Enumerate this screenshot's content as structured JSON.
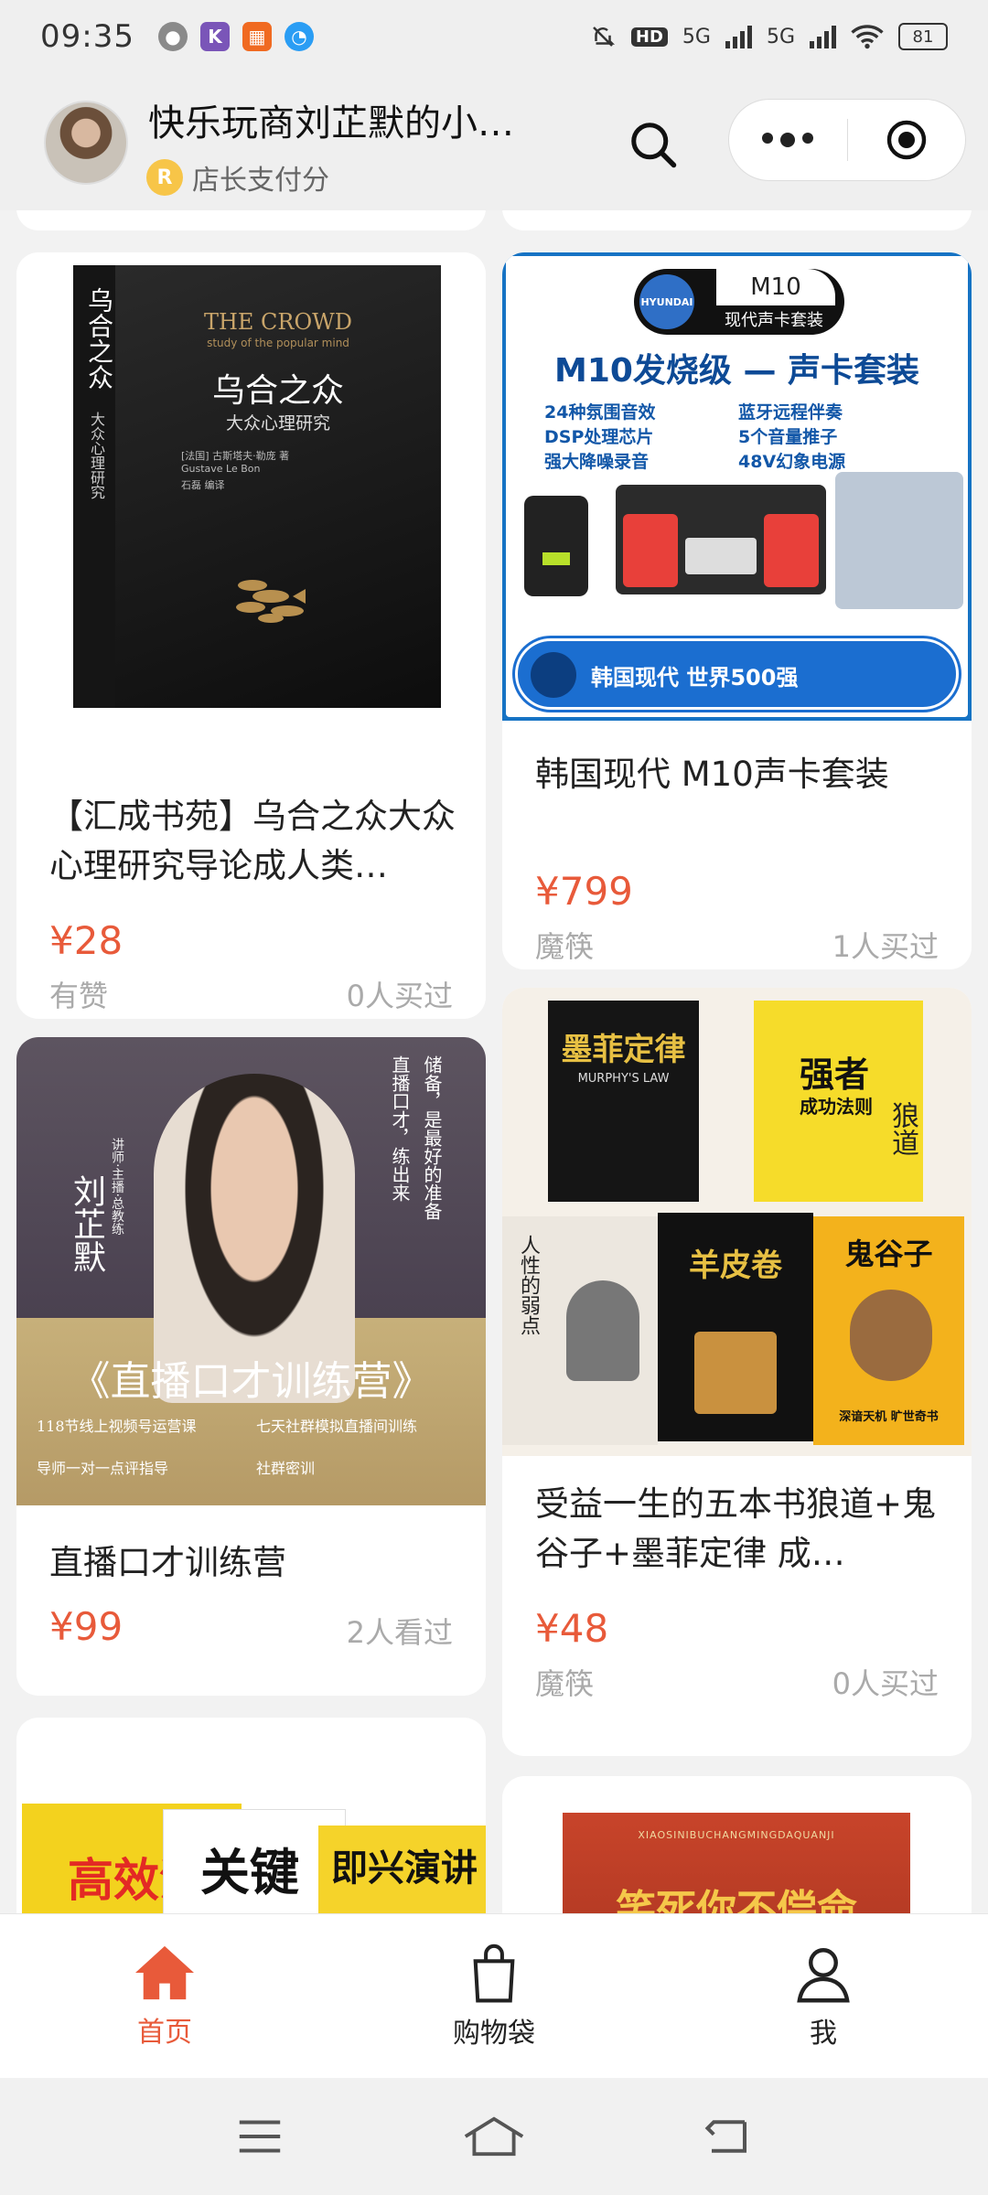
{
  "status_bar": {
    "time": "09:35",
    "network": "5G",
    "network2": "5G",
    "hd": "HD",
    "battery": "81"
  },
  "header": {
    "shop_name": "快乐玩商刘芷默的小…",
    "subtitle": "店长支付分"
  },
  "products": [
    {
      "title": "【汇成书苑】乌合之众大众心理研究导论成人类…",
      "price": "¥28",
      "seller": "有赞",
      "stat": "0人买过",
      "cover": {
        "en_title": "THE CROWD",
        "en_sub": "study of the popular mind",
        "cn_title": "乌合之众",
        "cn_sub": "大众心理研究",
        "author": "[法国] 古斯塔夫·勒庞 著",
        "author_en": "Gustave Le Bon",
        "translator": "石磊 编译",
        "spine": "乌合之众",
        "spine_sub": "大众心理研究"
      }
    },
    {
      "title": "韩国现代 M10声卡套装",
      "price": "¥799",
      "seller": "魔筷",
      "stat": "1人买过",
      "cover": {
        "model": "M10",
        "brand": "HYUNDAI",
        "model_sub": "现代声卡套装",
        "headline": "M10发烧级 — 声卡套装",
        "feat1": "24种氛围音效",
        "feat2": "蓝牙远程伴奏",
        "feat3": "DSP处理芯片",
        "feat4": "5个音量推子",
        "feat5": "强大降噪录音",
        "feat6": "48V幻象电源",
        "footer": "韩国现代 世界500强"
      }
    },
    {
      "title": "直播口才训练营",
      "price": "¥99",
      "seller": "",
      "stat": "2人看过",
      "cover": {
        "name": "刘芷默",
        "role": "讲师·主播·总教练",
        "slogan1": "储备，是最好的准备",
        "slogan2": "直播口才，练出来",
        "headline": "《直播口才训练营》",
        "item1": "118节线上视频号运营课",
        "item2": "七天社群模拟直播间训练",
        "item3": "导师一对一点评指导",
        "item4": "社群密训"
      }
    },
    {
      "title": "受益一生的五本书狼道+鬼谷子+墨菲定律 成…",
      "price": "¥48",
      "seller": "魔筷",
      "stat": "0人买过",
      "cover": {
        "book1": "墨菲定律",
        "book1_en": "MURPHY'S LAW",
        "book2": "强者",
        "book2_sub": "成功法则",
        "book2_side": "狼道",
        "book3": "人性的弱点",
        "book4": "羊皮卷",
        "book5": "鬼谷子",
        "book5_sub": "深谙天机 旷世奇书"
      }
    }
  ],
  "partial_cards": {
    "left": {
      "text1": "高效沟通",
      "text2": "关键对话",
      "text3": "即兴演讲"
    },
    "right": {
      "text1": "XIAOSINIBUCHANGMINGDAQUANJI",
      "text2": "笑死你不偿命"
    }
  },
  "bottom_nav": [
    {
      "label": "首页",
      "icon": "home-icon",
      "active": true
    },
    {
      "label": "购物袋",
      "icon": "bag-icon",
      "active": false
    },
    {
      "label": "我",
      "icon": "user-icon",
      "active": false
    }
  ],
  "colors": {
    "accent": "#e85a3a",
    "background": "#f2f2f2"
  }
}
